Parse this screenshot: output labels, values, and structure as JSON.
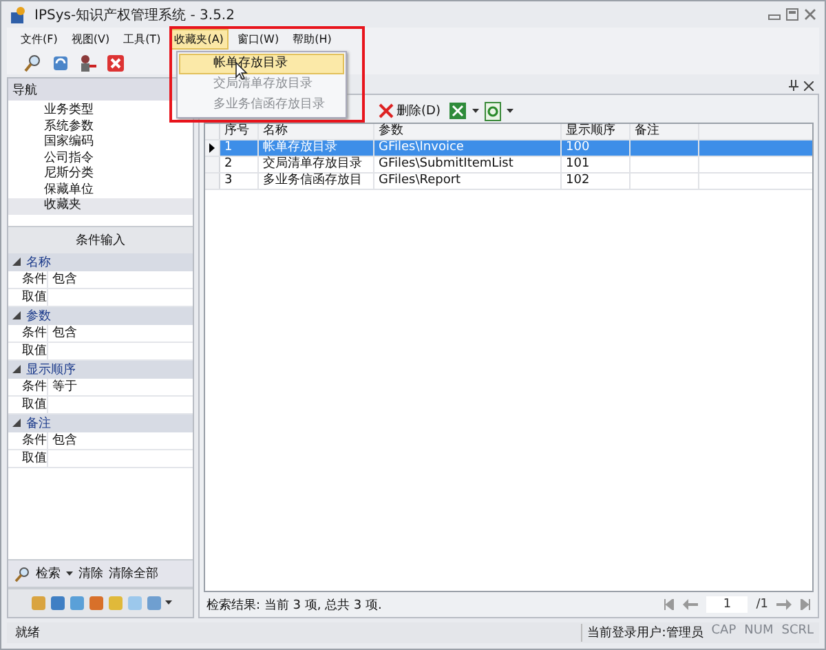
{
  "window": {
    "title": "IPSys-知识产权管理系统 - 3.5.2"
  },
  "menu": [
    {
      "label": "文件(F)",
      "selected": false
    },
    {
      "label": "视图(V)",
      "selected": false
    },
    {
      "label": "工具(T)",
      "selected": false
    },
    {
      "label": "收藏夹(A)",
      "selected": true
    },
    {
      "label": "窗口(W)",
      "selected": false
    },
    {
      "label": "帮助(H)",
      "selected": false
    }
  ],
  "dropdown": {
    "items": [
      {
        "label": "帐单存放目录",
        "selected": true,
        "disabled": false
      },
      {
        "label": "交局清单存放目录",
        "selected": false,
        "disabled": true
      },
      {
        "label": "多业务信函存放目录",
        "selected": false,
        "disabled": true
      }
    ]
  },
  "navigation": {
    "title": "导航",
    "items": [
      {
        "label": "业务类型",
        "selected": false
      },
      {
        "label": "系统参数",
        "selected": false
      },
      {
        "label": "国家编码",
        "selected": false
      },
      {
        "label": "公司指令",
        "selected": false
      },
      {
        "label": "尼斯分类",
        "selected": false
      },
      {
        "label": "保藏单位",
        "selected": false
      },
      {
        "label": "收藏夹",
        "selected": true
      }
    ]
  },
  "condition_panel": {
    "title": "条件输入",
    "groups": [
      {
        "name": "名称",
        "expanded": true,
        "rows": [
          {
            "label": "条件",
            "value": "包含"
          },
          {
            "label": "取值"
          }
        ]
      },
      {
        "name": "参数",
        "expanded": true,
        "rows": [
          {
            "label": "条件",
            "value": "包含"
          },
          {
            "label": "取值"
          }
        ]
      },
      {
        "name": "显示顺序",
        "expanded": true,
        "rows": [
          {
            "label": "条件",
            "value": "等于"
          },
          {
            "label": "取值"
          }
        ]
      },
      {
        "name": "备注",
        "expanded": true,
        "rows": [
          {
            "label": "条件",
            "value": "包含"
          },
          {
            "label": "取值"
          }
        ]
      }
    ]
  },
  "search_bar": {
    "search": "检索",
    "clear": "清除",
    "clear_all": "清除全部"
  },
  "grid_toolbar": {
    "delete": "删除(D)"
  },
  "table": {
    "columns": [
      "序号",
      "名称",
      "参数",
      "显示顺序",
      "备注"
    ],
    "rows": [
      {
        "cells": [
          "1",
          "帐单存放目录",
          "GFiles\\Invoice",
          "100"
        ],
        "selected": true
      },
      {
        "cells": [
          "2",
          "交局清单存放目录",
          "GFiles\\SubmitItemList",
          "101"
        ],
        "selected": false
      },
      {
        "cells": [
          "3",
          "多业务信函存放目",
          "GFiles\\Report",
          "102"
        ],
        "selected": false
      }
    ]
  },
  "result": "检索结果: 当前 3 项, 总共 3 项.",
  "pager": {
    "page": "1",
    "total": "/1"
  },
  "status_bar": {
    "status": "就绪",
    "user": "当前登录用户:管理员",
    "indicators": [
      "CAP",
      "NUM",
      "SCRL"
    ]
  }
}
